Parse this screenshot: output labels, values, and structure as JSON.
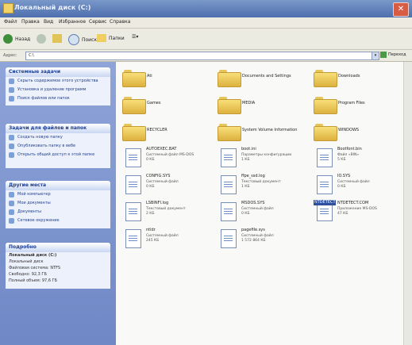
{
  "window": {
    "title": "Локальный диск (C:)",
    "close_glyph": "✕"
  },
  "menu": [
    "Файл",
    "Правка",
    "Вид",
    "Избранное",
    "Сервис",
    "Справка"
  ],
  "toolbar": {
    "back_label": "Назад",
    "search_label": "Поиск",
    "folders_label": "Папки",
    "view_label": "☰▾"
  },
  "address": {
    "label": "Адрес:",
    "value": "C:\\",
    "go_label": "Переход"
  },
  "left_panels": {
    "system": {
      "title": "Системные задачи",
      "items": [
        "Скрыть содержимое этого устройства",
        "Установка и удаление программ",
        "Поиск файлов или папок"
      ]
    },
    "tasks": {
      "title": "Задачи для файлов и папок",
      "items": [
        "Создать новую папку",
        "Опубликовать папку в вебе",
        "Открыть общий доступ к этой папке"
      ]
    },
    "places": {
      "title": "Другие места",
      "items": [
        "Мой компьютер",
        "Мои документы",
        "Документы",
        "Сетевое окружение"
      ]
    },
    "details": {
      "title": "Подробно",
      "lines": [
        "Локальный диск (C:)",
        "Локальный диск",
        "Файловая система: NTFS",
        "Свободно: 92,3 ГБ",
        "Полный объем: 97,6 ГБ"
      ]
    }
  },
  "files": [
    {
      "name": "Ati",
      "kind": "folder"
    },
    {
      "name": "Documents and Settings",
      "kind": "folder"
    },
    {
      "name": "Downloads",
      "kind": "folder"
    },
    {
      "name": "Games",
      "kind": "folder"
    },
    {
      "name": "MEDIA",
      "kind": "folder"
    },
    {
      "name": "Program Files",
      "kind": "folder"
    },
    {
      "name": "RECYCLER",
      "kind": "folder"
    },
    {
      "name": "System Volume Information",
      "kind": "folder"
    },
    {
      "name": "WINDOWS",
      "kind": "folder"
    },
    {
      "name": "AUTOEXEC.BAT",
      "kind": "file",
      "sub": "Системный файл MS-DOS",
      "size": "0 КБ"
    },
    {
      "name": "boot.ini",
      "kind": "file",
      "sub": "Параметры конфигурации",
      "size": "1 КБ"
    },
    {
      "name": "Bootfont.bin",
      "kind": "file",
      "sub": "Файл «BIN»",
      "size": "5 КБ"
    },
    {
      "name": "CONFIG.SYS",
      "kind": "file",
      "sub": "Системный файл",
      "size": "0 КБ"
    },
    {
      "name": "ffpe_ssd.log",
      "kind": "file",
      "sub": "Текстовый документ",
      "size": "1 КБ"
    },
    {
      "name": "IO.SYS",
      "kind": "file",
      "sub": "Системный файл",
      "size": "0 КБ"
    },
    {
      "name": "LSBINFI.log",
      "kind": "file",
      "sub": "Текстовый документ",
      "size": "2 КБ"
    },
    {
      "name": "MSDOS.SYS",
      "kind": "file",
      "sub": "Системный файл",
      "size": "0 КБ"
    },
    {
      "name": "NTDETECT.COM",
      "kind": "file",
      "sub": "Приложение MS-DOS",
      "size": "47 КБ",
      "selected": true,
      "selected_label": "NTDETECT"
    },
    {
      "name": "ntldr",
      "kind": "file",
      "sub": "Системный файл",
      "size": "245 КБ"
    },
    {
      "name": "pagefile.sys",
      "kind": "file",
      "sub": "Системный файл",
      "size": "1 572 864 КБ"
    }
  ],
  "colors": {
    "title_bar": "#5b79b8",
    "task_pane": "#7d93cd",
    "folder": "#f0cf62"
  }
}
